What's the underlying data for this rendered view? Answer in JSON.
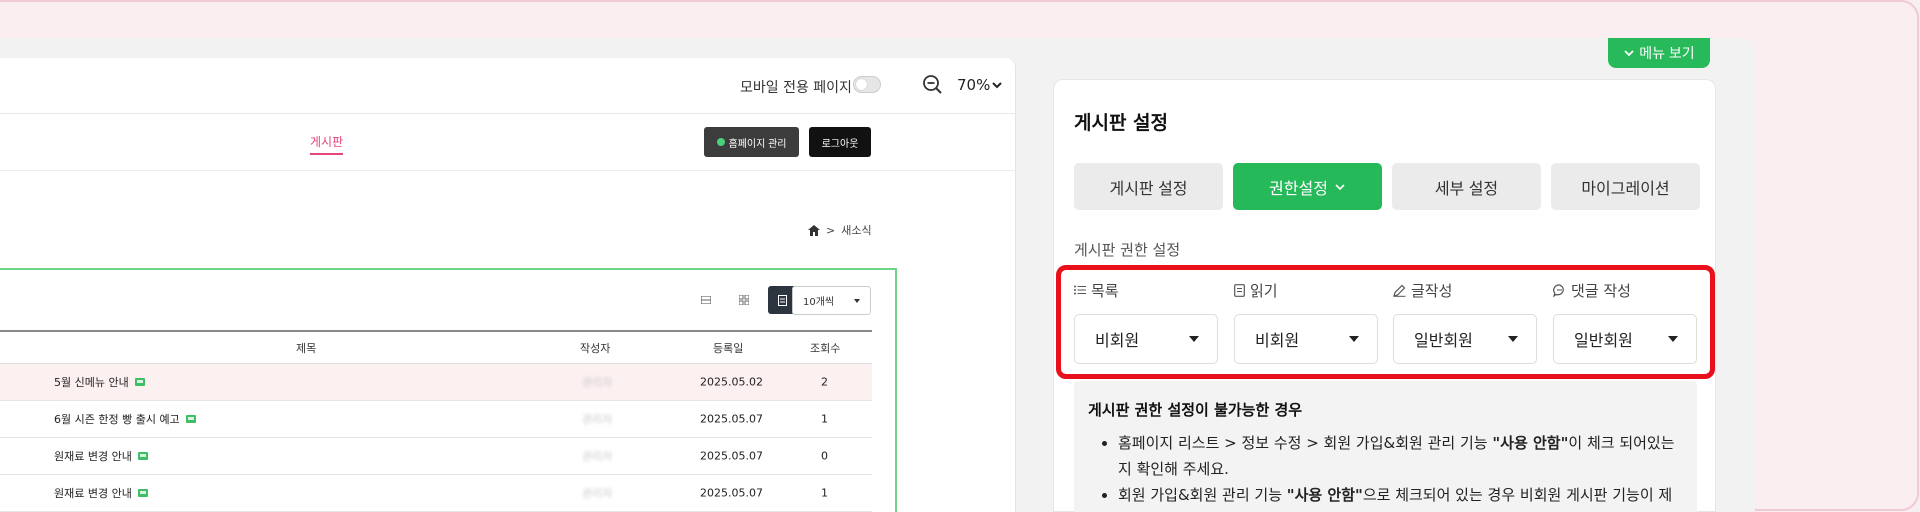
{
  "preview": {
    "mobile_only_label": "모바일 전용 페이지",
    "zoom_level": "70%",
    "nav": {
      "board": "게시판"
    },
    "buttons": {
      "home_admin": "홈페이지 관리",
      "logout": "로그아웃"
    },
    "breadcrumb": {
      "current": "새소식",
      "separator": ">"
    },
    "per_page": "10개씩",
    "table": {
      "headers": {
        "title": "제목",
        "author": "작성자",
        "date": "등록일",
        "views": "조회수"
      },
      "rows": [
        {
          "title": "5월 신메뉴 안내",
          "author": "관리자",
          "date": "2025.05.02",
          "views": "2"
        },
        {
          "title": "6월 시즌 한정 빵 출시 예고",
          "author": "관리자",
          "date": "2025.05.07",
          "views": "1"
        },
        {
          "title": "원재료 변경 안내",
          "author": "관리자",
          "date": "2025.05.07",
          "views": "0"
        },
        {
          "title": "원재료 변경 안내",
          "author": "관리자",
          "date": "2025.05.07",
          "views": "1"
        }
      ]
    }
  },
  "settings": {
    "menu_view_label": "메뉴 보기",
    "title": "게시판 설정",
    "tabs": [
      {
        "label": "게시판 설정"
      },
      {
        "label": "권한설정"
      },
      {
        "label": "세부 설정"
      },
      {
        "label": "마이그레이션"
      }
    ],
    "section_label": "게시판 권한 설정",
    "permissions": [
      {
        "label": "목록",
        "icon": "list-icon",
        "value": "비회원"
      },
      {
        "label": "읽기",
        "icon": "document-icon",
        "value": "비회원"
      },
      {
        "label": "글작성",
        "icon": "pencil-icon",
        "value": "일반회원"
      },
      {
        "label": "댓글 작성",
        "icon": "comment-icon",
        "value": "일반회원"
      }
    ],
    "notice": {
      "title": "게시판 권한 설정이 불가능한 경우",
      "items": [
        {
          "before": "홈페이지 리스트 > 정보 수정 > 회원 가입&회원 관리 기능 ",
          "bold": "\"사용 안함\"",
          "after": "이 체크 되어있는지 확인해 주세요."
        },
        {
          "before": "회원 가입&회원 관리 기능 ",
          "bold": "\"사용 안함\"",
          "after": "으로 체크되어 있는 경우 비회원 게시판 기능이 제공"
        }
      ]
    }
  },
  "colors": {
    "accent_green": "#26b95a",
    "highlight_red": "#e8101b",
    "nav_pink": "#e4457d"
  }
}
